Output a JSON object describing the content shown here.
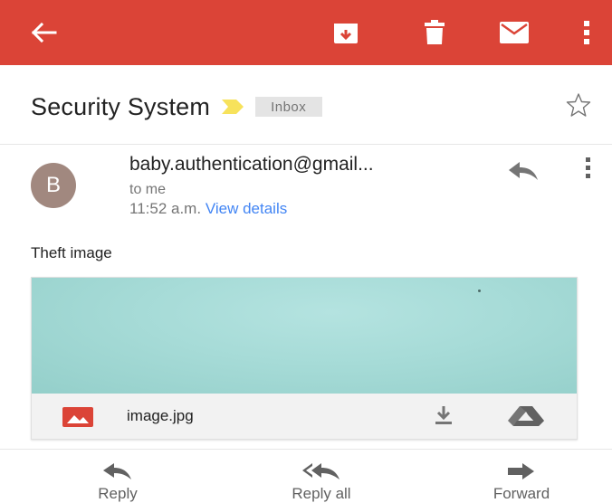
{
  "toolbar": {
    "back_icon": "arrow-left-icon",
    "archive_icon": "archive-icon",
    "delete_icon": "trash-icon",
    "mark_unread_icon": "envelope-icon",
    "more_icon": "more-vert-icon",
    "background_color": "#db4437"
  },
  "subject": {
    "title": "Security System",
    "label": "Inbox",
    "importance_color": "#f7e25b"
  },
  "message": {
    "avatar_letter": "B",
    "avatar_color": "#a1887f",
    "sender": "baby.authentication@gmail...",
    "recipient": "to me",
    "time": "11:52 a.m.",
    "details_link": "View details",
    "body": "Theft image"
  },
  "attachment": {
    "file_name": "image.jpg",
    "file_icon": "image-file-icon",
    "download_icon": "download-icon",
    "drive_icon": "drive-icon"
  },
  "actions": [
    {
      "label": "Reply",
      "icon": "reply-icon"
    },
    {
      "label": "Reply all",
      "icon": "reply-all-icon"
    },
    {
      "label": "Forward",
      "icon": "forward-icon"
    }
  ],
  "link_color": "#4285f4"
}
